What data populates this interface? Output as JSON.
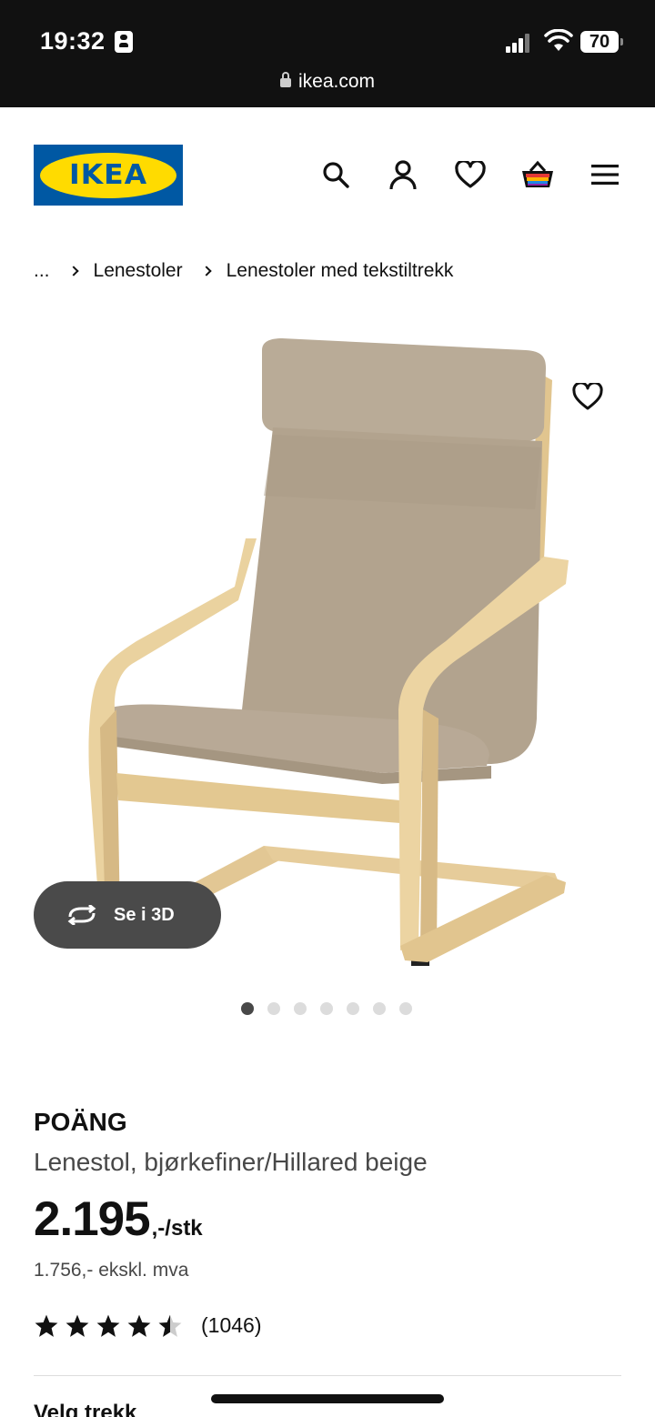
{
  "status_bar": {
    "time": "19:32",
    "battery": "70",
    "url": "ikea.com"
  },
  "header": {
    "logo_text": "IKEA",
    "icons": [
      "search-icon",
      "account-icon",
      "wishlist-heart-icon",
      "shopping-bag-icon",
      "menu-icon"
    ]
  },
  "breadcrumb": {
    "ellipsis": "...",
    "items": [
      "Lenestoler",
      "Lenestoler med tekstiltrekk"
    ]
  },
  "gallery": {
    "view_3d_label": "Se i 3D",
    "image_count": 7,
    "active_index": 0
  },
  "product": {
    "name": "POÄNG",
    "description": "Lenestol, bjørkefiner/Hillared beige",
    "price_main": "2.195",
    "price_unit": ",-/stk",
    "price_ex_vat": "1.756,- ekskl. mva",
    "rating": 4.5,
    "rating_count": "(1046)"
  },
  "next_section_title": "Velg trekk",
  "colors": {
    "ikea_blue": "#0058a3",
    "ikea_yellow": "#ffdb00",
    "fabric": "#b8a996",
    "wood": "#e8cf9c"
  }
}
